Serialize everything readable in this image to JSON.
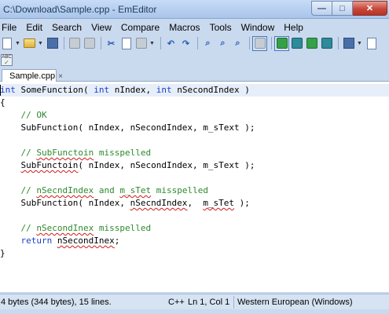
{
  "window": {
    "title": "C:\\Download\\Sample.cpp - EmEditor",
    "minimize_glyph": "—",
    "maximize_glyph": "□",
    "close_glyph": "✕"
  },
  "menu": {
    "items": [
      "File",
      "Edit",
      "Search",
      "View",
      "Compare",
      "Macros",
      "Tools",
      "Window",
      "Help"
    ]
  },
  "toolbar": {
    "icons": [
      "new-file-icon",
      "open-folder-icon",
      "save-icon",
      "print-icon",
      "print-preview-icon",
      "cut-icon",
      "copy-icon",
      "paste-icon",
      "undo-icon",
      "redo-icon",
      "find-icon",
      "find-next-icon",
      "find-previous-icon",
      "highlight-icon",
      "word-wrap-icon",
      "outline-icon",
      "split-view-icon",
      "macro-icon",
      "properties-icon"
    ]
  },
  "toolbar2": {
    "spell_label": "ABC"
  },
  "tabs": [
    {
      "label": "Sample.cpp",
      "close": "×"
    }
  ],
  "editor": {
    "lines": [
      [
        {
          "t": "int",
          "c": "kw"
        },
        {
          "t": " SomeFunction( ",
          "c": "tx"
        },
        {
          "t": "int",
          "c": "kw"
        },
        {
          "t": " nIndex, ",
          "c": "tx"
        },
        {
          "t": "int",
          "c": "kw"
        },
        {
          "t": " nSecondIndex )",
          "c": "tx"
        }
      ],
      [
        {
          "t": "{",
          "c": "tx"
        }
      ],
      [
        {
          "t": "    // OK",
          "c": "cm"
        }
      ],
      [
        {
          "t": "    SubFunction( nIndex, nSecondIndex, m_sText );",
          "c": "tx"
        }
      ],
      [],
      [
        {
          "t": "    // ",
          "c": "cm"
        },
        {
          "t": "SubFunctoin",
          "c": "cm",
          "sq": true
        },
        {
          "t": " misspelled",
          "c": "cm"
        }
      ],
      [
        {
          "t": "    ",
          "c": "tx"
        },
        {
          "t": "SubFunctoin",
          "c": "tx",
          "sq": true
        },
        {
          "t": "( nIndex, nSecondIndex, m_sText );",
          "c": "tx"
        }
      ],
      [],
      [
        {
          "t": "    // ",
          "c": "cm"
        },
        {
          "t": "nSecndIndex",
          "c": "cm",
          "sq": true
        },
        {
          "t": " and ",
          "c": "cm"
        },
        {
          "t": "m_sTet",
          "c": "cm",
          "sq": true
        },
        {
          "t": " misspelled",
          "c": "cm"
        }
      ],
      [
        {
          "t": "    SubFunction( nIndex, ",
          "c": "tx"
        },
        {
          "t": "nSecndIndex",
          "c": "tx",
          "sq": true
        },
        {
          "t": ",  ",
          "c": "tx"
        },
        {
          "t": "m_sTet",
          "c": "tx",
          "sq": true
        },
        {
          "t": " );",
          "c": "tx"
        }
      ],
      [],
      [
        {
          "t": "    // ",
          "c": "cm"
        },
        {
          "t": "nSecondInex",
          "c": "cm",
          "sq": true
        },
        {
          "t": " misspelled",
          "c": "cm"
        }
      ],
      [
        {
          "t": "    ",
          "c": "tx"
        },
        {
          "t": "return",
          "c": "kw"
        },
        {
          "t": " ",
          "c": "tx"
        },
        {
          "t": "nSecondInex",
          "c": "tx",
          "sq": true
        },
        {
          "t": ";",
          "c": "tx"
        }
      ],
      [
        {
          "t": "}",
          "c": "tx"
        }
      ],
      []
    ]
  },
  "status": {
    "size_text": "4 bytes (344 bytes), 15 lines.",
    "language": "C++",
    "position": "Ln 1, Col 1",
    "encoding": "Western European (Windows)"
  }
}
